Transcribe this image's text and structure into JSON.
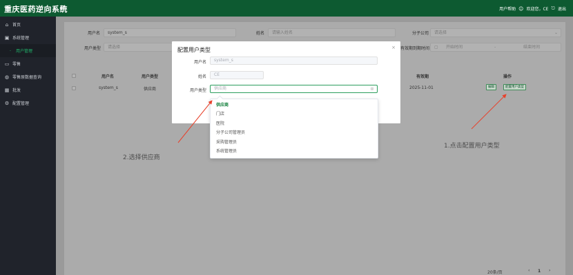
{
  "header": {
    "title": "重庆医药逆向系统",
    "help": "用户帮助",
    "welcome": "欢迎您，CE",
    "logout": "退出"
  },
  "sidebar": {
    "items": [
      {
        "label": "首页",
        "icon": "home-icon"
      },
      {
        "label": "系统管理",
        "icon": "settings-box-icon"
      },
      {
        "label": "用户管理",
        "icon": ""
      },
      {
        "label": "零售",
        "icon": "monitor-icon"
      },
      {
        "label": "零售原数据查询",
        "icon": "lock-icon"
      },
      {
        "label": "批发",
        "icon": "building-icon"
      },
      {
        "label": "配置管理",
        "icon": "gear-icon"
      }
    ]
  },
  "filters": {
    "username_label": "用户名",
    "username_value": "system_s",
    "name_label": "姓名",
    "name_placeholder": "请输入姓名",
    "branch_label": "分子公司",
    "branch_placeholder": "请选择",
    "usertype_label": "用户类型",
    "usertype_placeholder": "请选择",
    "expire_label": "有效期到期时间",
    "start_placeholder": "开始时间",
    "range_sep": "-",
    "end_placeholder": "结束时间"
  },
  "table": {
    "headers": [
      "用户名",
      "用户类型",
      "有效期",
      "操作"
    ],
    "rows": [
      {
        "username": "system_s",
        "usertype": "供应商",
        "expire": "2025-11-01",
        "edit": "编辑",
        "config": "配置用户类型"
      }
    ]
  },
  "modal": {
    "title": "配置用户类型",
    "close": "×",
    "username_label": "用户名",
    "username_value": "system_s",
    "name_label": "姓名",
    "name_value": "CE",
    "usertype_label": "用户类型",
    "usertype_placeholder": "供应商"
  },
  "dropdown": {
    "options": [
      "供应商",
      "门店",
      "医院",
      "分子公司管理员",
      "采购管理员",
      "系统管理员"
    ],
    "selected": "供应商"
  },
  "annotations": {
    "step1": "1.点击配置用户类型",
    "step2": "2.选择供应商"
  },
  "pagination": {
    "page_size": "20条/页",
    "current": "1"
  },
  "colors": {
    "header": "#0d5a31",
    "sidebar": "#20232b",
    "accent": "#15803d",
    "arrow": "#e8412b"
  }
}
